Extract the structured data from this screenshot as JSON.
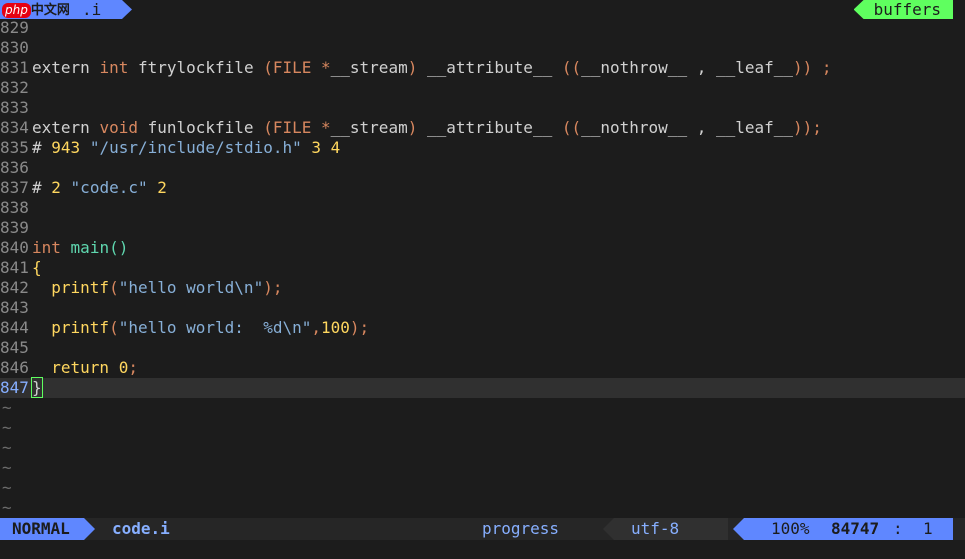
{
  "tabline": {
    "active_tab": ".i",
    "watermark_logo": "php",
    "watermark_text": "中文网",
    "buffers_label": "buffers"
  },
  "code": {
    "lines": [
      {
        "num": "829",
        "tokens": []
      },
      {
        "num": "830",
        "tokens": []
      },
      {
        "num": "831",
        "tokens": [
          {
            "t": "extern ",
            "c": "k-text"
          },
          {
            "t": "int",
            "c": "k-type"
          },
          {
            "t": " ftrylockfile ",
            "c": "k-text"
          },
          {
            "t": "(",
            "c": "k-par"
          },
          {
            "t": "FILE",
            "c": "k-type"
          },
          {
            "t": " *",
            "c": "k-par"
          },
          {
            "t": "__stream",
            "c": "k-text"
          },
          {
            "t": ")",
            "c": "k-par"
          },
          {
            "t": " __attribute__ ",
            "c": "k-text"
          },
          {
            "t": "((",
            "c": "k-par"
          },
          {
            "t": "__nothrow__ , __leaf__",
            "c": "k-text"
          },
          {
            "t": ")) ;",
            "c": "k-par"
          }
        ]
      },
      {
        "num": "832",
        "tokens": []
      },
      {
        "num": "833",
        "tokens": []
      },
      {
        "num": "834",
        "tokens": [
          {
            "t": "extern ",
            "c": "k-text"
          },
          {
            "t": "void",
            "c": "k-type"
          },
          {
            "t": " funlockfile ",
            "c": "k-text"
          },
          {
            "t": "(",
            "c": "k-par"
          },
          {
            "t": "FILE",
            "c": "k-type"
          },
          {
            "t": " *",
            "c": "k-par"
          },
          {
            "t": "__stream",
            "c": "k-text"
          },
          {
            "t": ")",
            "c": "k-par"
          },
          {
            "t": " __attribute__ ",
            "c": "k-text"
          },
          {
            "t": "((",
            "c": "k-par"
          },
          {
            "t": "__nothrow__ , __leaf__",
            "c": "k-text"
          },
          {
            "t": "));",
            "c": "k-par"
          }
        ]
      },
      {
        "num": "835",
        "tokens": [
          {
            "t": "# ",
            "c": "k-text"
          },
          {
            "t": "943",
            "c": "k-num"
          },
          {
            "t": " ",
            "c": "k-text"
          },
          {
            "t": "\"/usr/include/stdio.h\"",
            "c": "k-str"
          },
          {
            "t": " ",
            "c": "k-text"
          },
          {
            "t": "3 4",
            "c": "k-num"
          }
        ]
      },
      {
        "num": "836",
        "tokens": []
      },
      {
        "num": "837",
        "tokens": [
          {
            "t": "# ",
            "c": "k-text"
          },
          {
            "t": "2",
            "c": "k-num"
          },
          {
            "t": " ",
            "c": "k-text"
          },
          {
            "t": "\"code.c\"",
            "c": "k-str"
          },
          {
            "t": " ",
            "c": "k-text"
          },
          {
            "t": "2",
            "c": "k-num"
          }
        ]
      },
      {
        "num": "838",
        "tokens": []
      },
      {
        "num": "839",
        "tokens": []
      },
      {
        "num": "840",
        "tokens": [
          {
            "t": "int",
            "c": "k-type"
          },
          {
            "t": " ",
            "c": "k-text"
          },
          {
            "t": "main",
            "c": "k-fn"
          },
          {
            "t": "()",
            "c": "k-fn"
          }
        ]
      },
      {
        "num": "841",
        "tokens": [
          {
            "t": "{",
            "c": "k-num"
          }
        ]
      },
      {
        "num": "842",
        "tokens": [
          {
            "t": "  ",
            "c": "k-text"
          },
          {
            "t": "printf",
            "c": "k-num"
          },
          {
            "t": "(",
            "c": "k-par"
          },
          {
            "t": "\"hello world\\n\"",
            "c": "k-str"
          },
          {
            "t": ");",
            "c": "k-par"
          }
        ]
      },
      {
        "num": "843",
        "tokens": []
      },
      {
        "num": "844",
        "tokens": [
          {
            "t": "  ",
            "c": "k-text"
          },
          {
            "t": "printf",
            "c": "k-num"
          },
          {
            "t": "(",
            "c": "k-par"
          },
          {
            "t": "\"hello world:  %d\\n\"",
            "c": "k-str"
          },
          {
            "t": ",",
            "c": "k-par"
          },
          {
            "t": "100",
            "c": "k-num"
          },
          {
            "t": ");",
            "c": "k-par"
          }
        ]
      },
      {
        "num": "845",
        "tokens": []
      },
      {
        "num": "846",
        "tokens": [
          {
            "t": "  return ",
            "c": "k-num"
          },
          {
            "t": "0",
            "c": "k-num"
          },
          {
            "t": ";",
            "c": "k-par"
          }
        ]
      },
      {
        "num": "847",
        "tokens": [
          {
            "t": "}",
            "c": "cursor"
          }
        ],
        "current": true
      }
    ],
    "tilde_rows": [
      "~",
      "~",
      "~",
      "~",
      "~",
      "~"
    ]
  },
  "statusline": {
    "mode": "NORMAL",
    "filename": "code.i",
    "progress_label": "progress",
    "encoding": "utf-8",
    "percent": "100%",
    "line_number": "84747",
    "separator": ":",
    "column": "1"
  },
  "colors": {
    "background": "#1c1c1c",
    "accent_blue": "#5f87ff",
    "accent_green": "#5fff5f"
  }
}
